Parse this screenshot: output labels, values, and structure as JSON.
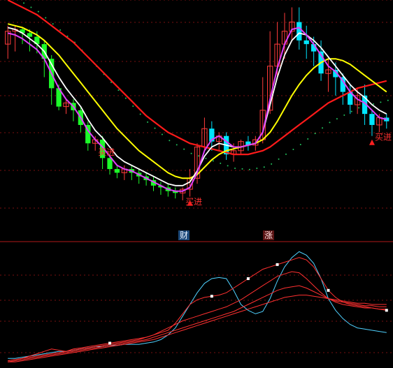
{
  "chart_data": [
    {
      "type": "candlestick",
      "panel": "price",
      "title": "",
      "xlabel": "",
      "ylabel": "",
      "grid": true,
      "background": "#000000",
      "colors": {
        "up": "#ff3b3b",
        "down_fill": "#00e5ff",
        "down_big": "#1dfc2a",
        "ma_white": "#ffffff",
        "ma_yellow": "#ffff00",
        "ma_red": "#ff1a1a",
        "ma_magenta": "#e040fb",
        "dots": "#22c55e",
        "signal": "#ff2020"
      },
      "candles": [
        [
          88,
          95,
          80,
          98
        ],
        [
          95,
          96,
          84,
          98
        ],
        [
          96,
          94,
          88,
          97
        ],
        [
          94,
          92,
          84,
          96
        ],
        [
          92,
          88,
          83,
          95
        ],
        [
          88,
          80,
          70,
          90
        ],
        [
          80,
          64,
          55,
          82
        ],
        [
          64,
          54,
          52,
          66
        ],
        [
          54,
          56,
          50,
          58
        ],
        [
          56,
          52,
          46,
          58
        ],
        [
          52,
          44,
          40,
          54
        ],
        [
          44,
          34,
          30,
          46
        ],
        [
          34,
          36,
          30,
          38
        ],
        [
          36,
          26,
          20,
          38
        ],
        [
          26,
          20,
          17,
          28
        ],
        [
          20,
          18,
          15,
          22
        ],
        [
          18,
          20,
          14,
          22
        ],
        [
          20,
          18,
          14,
          22
        ],
        [
          18,
          16,
          12,
          20
        ],
        [
          16,
          14,
          11,
          18
        ],
        [
          14,
          11,
          8,
          16
        ],
        [
          11,
          10,
          6,
          13
        ],
        [
          10,
          8,
          5,
          12
        ],
        [
          8,
          7,
          4,
          10
        ],
        [
          7,
          9,
          3,
          10
        ],
        [
          9,
          15,
          5,
          20
        ],
        [
          15,
          32,
          12,
          34
        ],
        [
          32,
          42,
          30,
          48
        ],
        [
          42,
          35,
          30,
          46
        ],
        [
          35,
          38,
          30,
          40
        ],
        [
          38,
          28,
          25,
          40
        ],
        [
          28,
          30,
          24,
          34
        ],
        [
          30,
          35,
          28,
          36
        ],
        [
          35,
          33,
          30,
          38
        ],
        [
          33,
          36,
          30,
          38
        ],
        [
          36,
          52,
          34,
          70
        ],
        [
          52,
          76,
          50,
          95
        ],
        [
          76,
          88,
          70,
          100
        ],
        [
          88,
          95,
          80,
          105
        ],
        [
          95,
          100,
          90,
          108
        ],
        [
          100,
          90,
          85,
          108
        ],
        [
          90,
          88,
          80,
          98
        ],
        [
          88,
          84,
          76,
          92
        ],
        [
          84,
          72,
          68,
          90
        ],
        [
          72,
          74,
          62,
          80
        ],
        [
          74,
          70,
          60,
          78
        ],
        [
          70,
          62,
          55,
          72
        ],
        [
          62,
          55,
          50,
          66
        ],
        [
          55,
          60,
          50,
          64
        ],
        [
          60,
          50,
          44,
          66
        ],
        [
          50,
          44,
          38,
          52
        ],
        [
          44,
          48,
          40,
          50
        ],
        [
          48,
          46,
          42,
          50
        ]
      ],
      "lines": {
        "magenta": [
          94,
          93,
          91,
          88,
          85,
          80,
          72,
          64,
          58,
          54,
          48,
          41,
          36,
          32,
          27,
          22,
          20,
          19,
          17,
          15,
          13,
          11,
          9,
          8,
          8,
          10,
          18,
          30,
          36,
          38,
          35,
          32,
          32,
          33,
          34,
          40,
          58,
          75,
          88,
          96,
          97,
          93,
          88,
          82,
          76,
          73,
          68,
          62,
          58,
          56,
          52,
          48,
          47
        ],
        "white": [
          97,
          96,
          94,
          91,
          88,
          84,
          77,
          70,
          64,
          59,
          54,
          47,
          41,
          37,
          32,
          27,
          24,
          22,
          20,
          18,
          16,
          14,
          12,
          11,
          11,
          13,
          19,
          27,
          32,
          34,
          33,
          32,
          32,
          33,
          34,
          40,
          55,
          70,
          82,
          90,
          94,
          93,
          90,
          86,
          81,
          76,
          71,
          66,
          62,
          59,
          55,
          52,
          50
        ],
        "yellow": [
          99,
          98,
          97,
          95,
          93,
          90,
          86,
          82,
          77,
          72,
          67,
          62,
          57,
          52,
          47,
          42,
          38,
          34,
          30,
          27,
          24,
          21,
          18,
          16,
          15,
          15,
          17,
          21,
          25,
          28,
          30,
          31,
          32,
          33,
          34,
          36,
          40,
          46,
          53,
          60,
          66,
          71,
          75,
          78,
          80,
          80,
          79,
          77,
          74,
          71,
          68,
          65,
          62
        ],
        "red": [
          112,
          110,
          108,
          106,
          104,
          101,
          98,
          95,
          92,
          89,
          85,
          81,
          77,
          73,
          69,
          65,
          61,
          57,
          53,
          49,
          46,
          43,
          40,
          38,
          36,
          34,
          33,
          32,
          31,
          30,
          29,
          28,
          28,
          28,
          29,
          30,
          32,
          35,
          38,
          41,
          44,
          47,
          50,
          53,
          56,
          58,
          60,
          62,
          64,
          65,
          66,
          67,
          68
        ]
      },
      "ylim": [
        -2,
        112
      ],
      "signals": [
        {
          "index": 12,
          "label": "买进",
          "type": "buy-text"
        },
        {
          "index": 24,
          "label": "买进",
          "type": "buy-text"
        },
        {
          "index": 25,
          "label": "",
          "type": "up-triangle"
        },
        {
          "index": 50,
          "label": "买进",
          "type": "buy-text"
        },
        {
          "index": 50,
          "label": "",
          "type": "up-triangle"
        }
      ]
    },
    {
      "type": "line",
      "panel": "indicator",
      "title": "",
      "xlabel": "",
      "ylabel": "",
      "grid": true,
      "ylim": [
        0,
        100
      ],
      "series": [
        {
          "color": "#4fd1ff",
          "values": [
            4,
            4,
            5,
            6,
            7,
            8,
            9,
            10,
            10,
            11,
            12,
            13,
            14,
            14,
            15,
            15,
            16,
            16,
            16,
            17,
            18,
            20,
            24,
            30,
            40,
            50,
            60,
            68,
            72,
            73,
            72,
            62,
            50,
            45,
            42,
            44,
            55,
            70,
            82,
            90,
            95,
            92,
            85,
            72,
            55,
            45,
            38,
            33,
            30,
            29,
            28,
            27,
            26
          ]
        },
        {
          "color": "#ff3030",
          "values": [
            2,
            3,
            4,
            6,
            8,
            10,
            12,
            11,
            10,
            12,
            13,
            14,
            15,
            16,
            17,
            18,
            19,
            20,
            21,
            22,
            24,
            26,
            28,
            34,
            42,
            50,
            54,
            56,
            57,
            58,
            60,
            64,
            68,
            72,
            76,
            80,
            82,
            84,
            86,
            88,
            90,
            88,
            82,
            72,
            62,
            56,
            52,
            50,
            49,
            48,
            47,
            46,
            45
          ]
        },
        {
          "color": "#ff3030",
          "values": [
            2,
            3,
            4,
            5,
            6,
            7,
            8,
            9,
            10,
            11,
            12,
            13,
            14,
            15,
            16,
            17,
            18,
            19,
            20,
            22,
            24,
            27,
            30,
            33,
            36,
            38,
            40,
            42,
            44,
            46,
            48,
            51,
            54,
            58,
            62,
            66,
            70,
            74,
            76,
            78,
            77,
            72,
            66,
            60,
            55,
            52,
            50,
            49,
            48,
            47,
            47,
            46,
            46
          ]
        },
        {
          "color": "#ff3030",
          "values": [
            1,
            2,
            3,
            4,
            5,
            6,
            7,
            8,
            9,
            10,
            11,
            12,
            13,
            14,
            15,
            16,
            17,
            18,
            19,
            20,
            22,
            24,
            26,
            28,
            30,
            32,
            34,
            36,
            38,
            40,
            42,
            44,
            47,
            50,
            53,
            56,
            59,
            62,
            64,
            65,
            66,
            64,
            61,
            58,
            55,
            53,
            52,
            51,
            50,
            49,
            49,
            48,
            48
          ]
        },
        {
          "color": "#ff3030",
          "values": [
            1,
            1,
            2,
            3,
            4,
            5,
            6,
            7,
            8,
            9,
            10,
            11,
            12,
            13,
            14,
            15,
            16,
            17,
            18,
            19,
            20,
            22,
            24,
            26,
            28,
            30,
            32,
            34,
            36,
            38,
            40,
            42,
            44,
            46,
            48,
            50,
            52,
            54,
            56,
            57,
            58,
            58,
            57,
            56,
            55,
            54,
            53,
            52,
            51,
            51,
            50,
            50,
            50
          ]
        }
      ]
    }
  ],
  "labels": {
    "tag_left": "财",
    "tag_right": "涨"
  }
}
